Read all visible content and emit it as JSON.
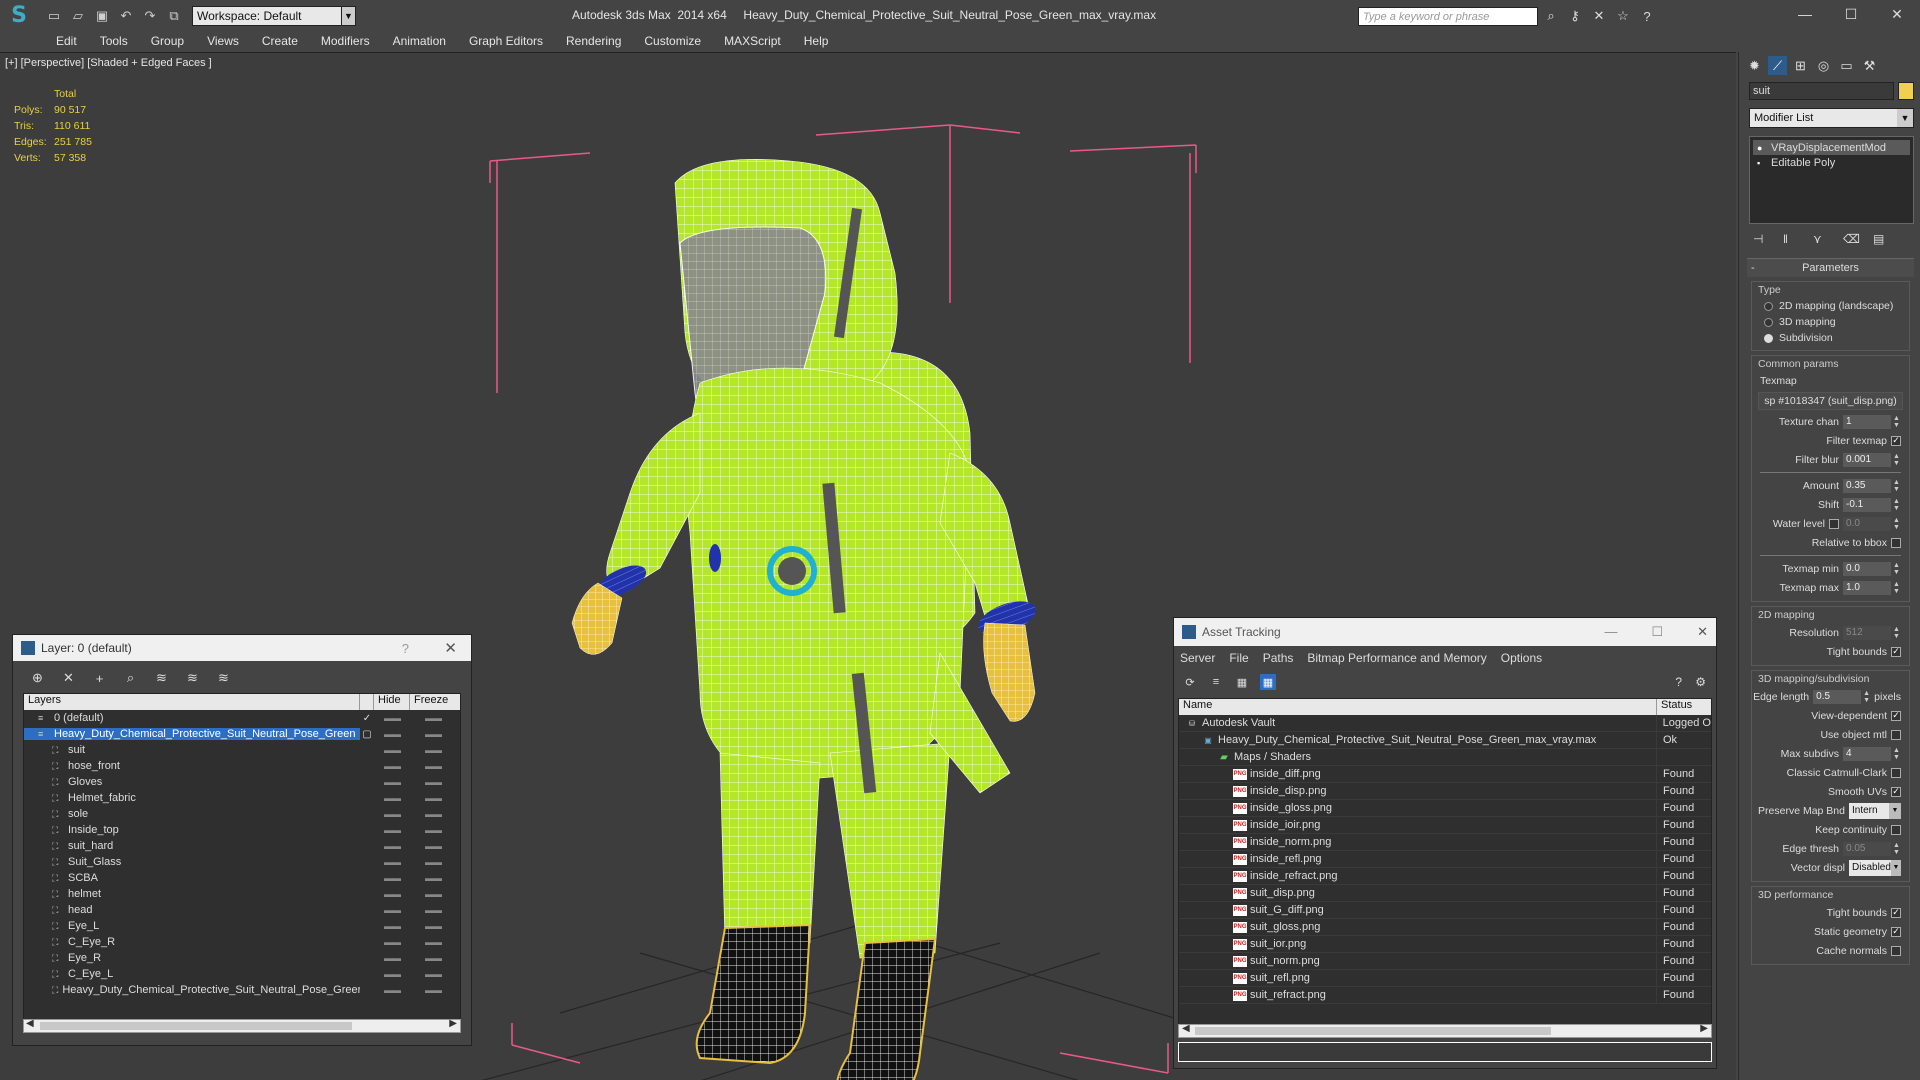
{
  "app": {
    "title": "Autodesk 3ds Max  2014 x64     Heavy_Duty_Chemical_Protective_Suit_Neutral_Pose_Green_max_vray.max",
    "workspace": "Workspace: Default",
    "search_placeholder": "Type a keyword or phrase"
  },
  "menu": [
    "Edit",
    "Tools",
    "Group",
    "Views",
    "Create",
    "Modifiers",
    "Animation",
    "Graph Editors",
    "Rendering",
    "Customize",
    "MAXScript",
    "Help"
  ],
  "viewport": {
    "label": "[+] [Perspective] [Shaded + Edged Faces ]",
    "stats": {
      "header": "Total",
      "rows": [
        {
          "k": "Polys:",
          "v": "90 517"
        },
        {
          "k": "Tris:",
          "v": "110 611"
        },
        {
          "k": "Edges:",
          "v": "251 785"
        },
        {
          "k": "Verts:",
          "v": "57 358"
        }
      ]
    }
  },
  "command_panel": {
    "object_name": "suit",
    "modifier_list": "Modifier List",
    "stack": [
      "VRayDisplacementMod",
      "Editable Poly"
    ],
    "rollout_title": "Parameters",
    "type_group": "Type",
    "type_options": [
      {
        "label": "2D mapping (landscape)",
        "on": false
      },
      {
        "label": "3D mapping",
        "on": false
      },
      {
        "label": "Subdivision",
        "on": true
      }
    ],
    "common_group": "Common params",
    "texmap_label": "Texmap",
    "texmap_value": "sp #1018347 (suit_disp.png)",
    "params1": [
      {
        "label": "Texture chan",
        "value": "1",
        "type": "num"
      },
      {
        "label": "Filter texmap",
        "type": "check",
        "checked": true
      },
      {
        "label": "Filter blur",
        "value": "0.001",
        "type": "num"
      }
    ],
    "params2": [
      {
        "label": "Amount",
        "value": "0.35",
        "type": "num"
      },
      {
        "label": "Shift",
        "value": "-0.1",
        "type": "num"
      },
      {
        "label": "Water level",
        "value": "0.0",
        "type": "numcheck"
      },
      {
        "label": "Relative to bbox",
        "type": "check",
        "checked": false
      }
    ],
    "params3": [
      {
        "label": "Texmap min",
        "value": "0.0",
        "type": "num"
      },
      {
        "label": "Texmap max",
        "value": "1.0",
        "type": "num"
      }
    ],
    "mapping2d_group": "2D mapping",
    "mapping2d": [
      {
        "label": "Resolution",
        "value": "512",
        "type": "numdis"
      },
      {
        "label": "Tight bounds",
        "type": "check",
        "checked": true
      }
    ],
    "mapping3d_group": "3D mapping/subdivision",
    "mapping3d": [
      {
        "label": "Edge length",
        "value": "0.5",
        "type": "numunit",
        "unit": "pixels"
      },
      {
        "label": "View-dependent",
        "type": "check",
        "checked": true
      },
      {
        "label": "Use object mtl",
        "type": "check",
        "checked": false
      },
      {
        "label": "Max subdivs",
        "value": "4",
        "type": "num"
      },
      {
        "label": "Classic Catmull-Clark",
        "type": "check",
        "checked": false
      },
      {
        "label": "Smooth UVs",
        "type": "check",
        "checked": true
      },
      {
        "label": "Preserve Map Bnd",
        "value": "Intern",
        "type": "dd"
      },
      {
        "label": "Keep continuity",
        "type": "check",
        "checked": false
      },
      {
        "label": "Edge thresh",
        "value": "0.05",
        "type": "numdis"
      },
      {
        "label": "Vector displ",
        "value": "Disabled",
        "type": "dd"
      }
    ],
    "perf_group": "3D performance",
    "perf": [
      {
        "label": "Tight bounds",
        "type": "check",
        "checked": true
      },
      {
        "label": "Static geometry",
        "type": "check",
        "checked": true
      },
      {
        "label": "Cache normals",
        "type": "check",
        "checked": false
      }
    ]
  },
  "layer_window": {
    "title": "Layer: 0 (default)",
    "help": "?",
    "columns": [
      "Layers",
      "Hide",
      "Freeze"
    ],
    "rows": [
      {
        "name": "0 (default)",
        "indent": 1,
        "check": "✓",
        "sel": false
      },
      {
        "name": "Heavy_Duty_Chemical_Protective_Suit_Neutral_Pose_Green",
        "indent": 1,
        "check": "▢",
        "sel": true
      },
      {
        "name": "suit",
        "indent": 2,
        "check": "",
        "sel": false
      },
      {
        "name": "hose_front",
        "indent": 2,
        "check": "",
        "sel": false
      },
      {
        "name": "Gloves",
        "indent": 2,
        "check": "",
        "sel": false
      },
      {
        "name": "Helmet_fabric",
        "indent": 2,
        "check": "",
        "sel": false
      },
      {
        "name": "sole",
        "indent": 2,
        "check": "",
        "sel": false
      },
      {
        "name": "Inside_top",
        "indent": 2,
        "check": "",
        "sel": false
      },
      {
        "name": "suit_hard",
        "indent": 2,
        "check": "",
        "sel": false
      },
      {
        "name": "Suit_Glass",
        "indent": 2,
        "check": "",
        "sel": false
      },
      {
        "name": "SCBA",
        "indent": 2,
        "check": "",
        "sel": false
      },
      {
        "name": "helmet",
        "indent": 2,
        "check": "",
        "sel": false
      },
      {
        "name": "head",
        "indent": 2,
        "check": "",
        "sel": false
      },
      {
        "name": "Eye_L",
        "indent": 2,
        "check": "",
        "sel": false
      },
      {
        "name": "C_Eye_R",
        "indent": 2,
        "check": "",
        "sel": false
      },
      {
        "name": "Eye_R",
        "indent": 2,
        "check": "",
        "sel": false
      },
      {
        "name": "C_Eye_L",
        "indent": 2,
        "check": "",
        "sel": false
      },
      {
        "name": "Heavy_Duty_Chemical_Protective_Suit_Neutral_Pose_Greer",
        "indent": 2,
        "check": "",
        "sel": false
      }
    ]
  },
  "asset_window": {
    "title": "Asset Tracking",
    "menu": [
      "Server",
      "File",
      "Paths",
      "Bitmap Performance and Memory",
      "Options"
    ],
    "columns": [
      "Name",
      "Status"
    ],
    "rows": [
      {
        "name": "Autodesk Vault",
        "indent": 1,
        "icon": "vault",
        "status": "Logged O"
      },
      {
        "name": "Heavy_Duty_Chemical_Protective_Suit_Neutral_Pose_Green_max_vray.max",
        "indent": 2,
        "icon": "file",
        "status": "Ok"
      },
      {
        "name": "Maps / Shaders",
        "indent": 3,
        "icon": "fold",
        "status": ""
      },
      {
        "name": "inside_diff.png",
        "indent": 4,
        "icon": "png",
        "status": "Found"
      },
      {
        "name": "inside_disp.png",
        "indent": 4,
        "icon": "png",
        "status": "Found"
      },
      {
        "name": "inside_gloss.png",
        "indent": 4,
        "icon": "png",
        "status": "Found"
      },
      {
        "name": "inside_ioir.png",
        "indent": 4,
        "icon": "png",
        "status": "Found"
      },
      {
        "name": "inside_norm.png",
        "indent": 4,
        "icon": "png",
        "status": "Found"
      },
      {
        "name": "inside_refl.png",
        "indent": 4,
        "icon": "png",
        "status": "Found"
      },
      {
        "name": "inside_refract.png",
        "indent": 4,
        "icon": "png",
        "status": "Found"
      },
      {
        "name": "suit_disp.png",
        "indent": 4,
        "icon": "png",
        "status": "Found"
      },
      {
        "name": "suit_G_diff.png",
        "indent": 4,
        "icon": "png",
        "status": "Found"
      },
      {
        "name": "suit_gloss.png",
        "indent": 4,
        "icon": "png",
        "status": "Found"
      },
      {
        "name": "suit_ior.png",
        "indent": 4,
        "icon": "png",
        "status": "Found"
      },
      {
        "name": "suit_norm.png",
        "indent": 4,
        "icon": "png",
        "status": "Found"
      },
      {
        "name": "suit_refl.png",
        "indent": 4,
        "icon": "png",
        "status": "Found"
      },
      {
        "name": "suit_refract.png",
        "indent": 4,
        "icon": "png",
        "status": "Found"
      }
    ]
  },
  "colors": {
    "suit": "#b4e62a",
    "wire": "#ffffff",
    "gloves": "#e8c040",
    "boots": "#1a1a1a",
    "bbox": "#e85a8a",
    "stats": "#e8d040",
    "selection": "#2d6ec4"
  }
}
